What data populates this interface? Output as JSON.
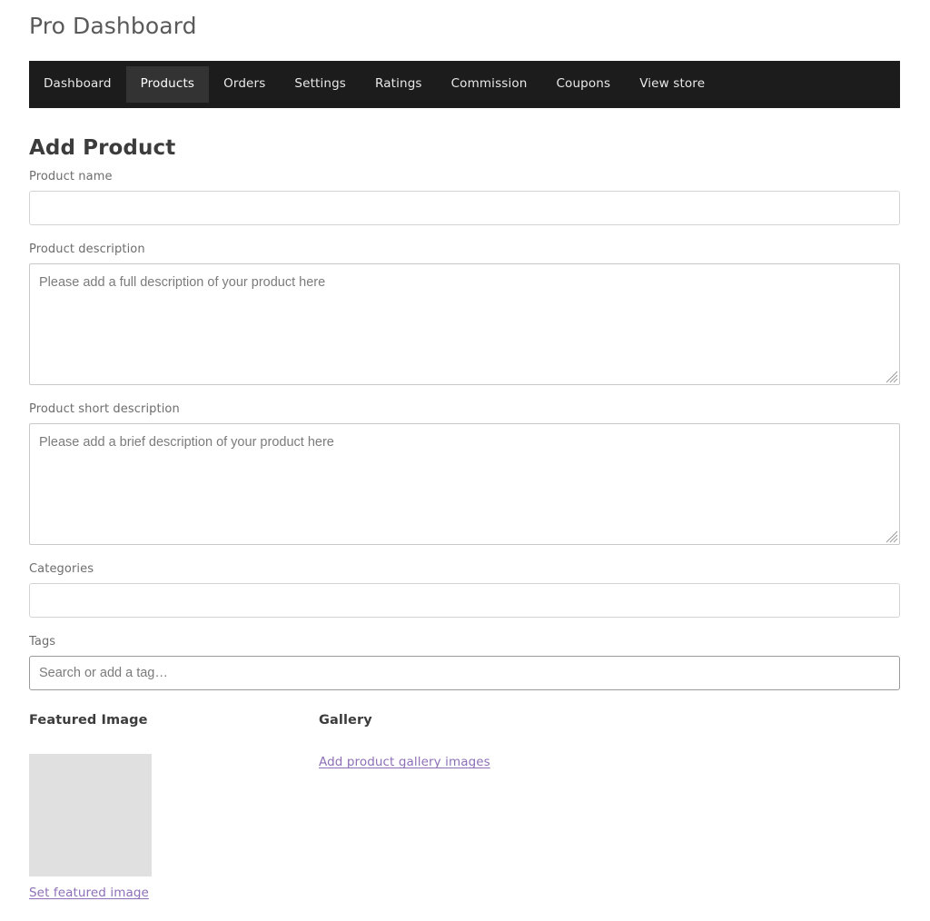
{
  "header": {
    "site_title": "Pro Dashboard"
  },
  "nav": {
    "items": [
      {
        "label": "Dashboard",
        "active": false
      },
      {
        "label": "Products",
        "active": true
      },
      {
        "label": "Orders",
        "active": false
      },
      {
        "label": "Settings",
        "active": false
      },
      {
        "label": "Ratings",
        "active": false
      },
      {
        "label": "Commission",
        "active": false
      },
      {
        "label": "Coupons",
        "active": false
      },
      {
        "label": "View store",
        "active": false
      }
    ]
  },
  "main": {
    "page_heading": "Add Product",
    "fields": {
      "product_name": {
        "label": "Product name",
        "value": "",
        "placeholder": ""
      },
      "product_description": {
        "label": "Product description",
        "value": "",
        "placeholder": "Please add a full description of your product here"
      },
      "product_short_description": {
        "label": "Product short description",
        "value": "",
        "placeholder": "Please add a brief description of your product here"
      },
      "categories": {
        "label": "Categories",
        "value": "",
        "placeholder": ""
      },
      "tags": {
        "label": "Tags",
        "value": "",
        "placeholder": "Search or add a tag…"
      }
    },
    "media": {
      "featured": {
        "heading": "Featured Image",
        "link_label": "Set featured image"
      },
      "gallery": {
        "heading": "Gallery",
        "link_label": "Add product gallery images"
      }
    }
  },
  "colors": {
    "nav_background": "#1c1c1c",
    "nav_active_background": "#333333",
    "nav_text": "#e9e9e9",
    "heading_text": "#3c3c3c",
    "label_text": "#6d6d6d",
    "link_purple": "#8d6fb8",
    "placeholder_text": "#7b7b7b",
    "thumb_placeholder": "#e0e0e0",
    "input_border": "#d4d4d4"
  }
}
